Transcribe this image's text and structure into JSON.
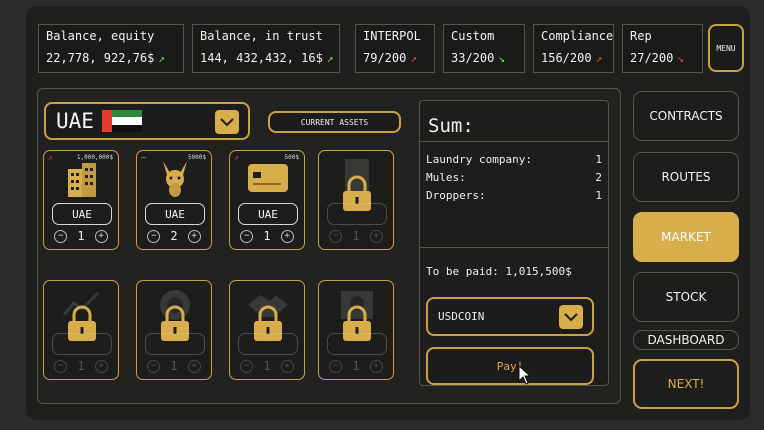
{
  "stats": [
    {
      "label": "Balance, equity",
      "value": "22,778, 922,76$",
      "trend": "up"
    },
    {
      "label": "Balance, in trust",
      "value": "144, 432,432, 16$",
      "trend": "up"
    },
    {
      "label": "INTERPOL",
      "value": "79/200",
      "trend": "down"
    },
    {
      "label": "Custom",
      "value": "33/200",
      "trend": "up"
    },
    {
      "label": "Compliance",
      "value": "156/200",
      "trend": "down"
    },
    {
      "label": "Rep",
      "value": "27/200",
      "trend": "down"
    }
  ],
  "menu_label": "MENU",
  "country": {
    "name": "UAE"
  },
  "current_assets_label": "CURRENT ASSETS",
  "cards": [
    {
      "icon": "building-icon",
      "amount": "1,000,000$",
      "label": "UAE",
      "qty": "1",
      "locked": false
    },
    {
      "icon": "donkey-icon",
      "amount": "5000$",
      "label": "UAE",
      "qty": "2",
      "locked": false
    },
    {
      "icon": "credit-card-icon",
      "amount": "500$",
      "label": "UAE",
      "qty": "1",
      "locked": false
    },
    {
      "icon": "document-icon",
      "amount": "",
      "label": "",
      "qty": "1",
      "locked": true
    },
    {
      "icon": "chart-icon",
      "amount": "",
      "label": "",
      "qty": "1",
      "locked": true
    },
    {
      "icon": "poker-chip-icon",
      "amount": "",
      "label": "",
      "qty": "1",
      "locked": true
    },
    {
      "icon": "handshake-icon",
      "amount": "",
      "label": "",
      "qty": "1",
      "locked": true
    },
    {
      "icon": "skull-icon",
      "amount": "",
      "label": "",
      "qty": "1",
      "locked": true
    }
  ],
  "sum": {
    "title": "Sum:",
    "rows": [
      {
        "label": "Laundry company:",
        "value": "1"
      },
      {
        "label": "Mules:",
        "value": "2"
      },
      {
        "label": "Droppers:",
        "value": "1"
      }
    ],
    "to_be_paid": "To be paid: 1,015,500$",
    "currency": "USDCOIN",
    "pay_label": "Pay!"
  },
  "nav": [
    "CONTRACTS",
    "ROUTES",
    "MARKET",
    "STOCK",
    "DASHBOARD",
    "NEXT!"
  ],
  "colors": {
    "gold": "#d8ad4c",
    "up": "#7ed957",
    "down": "#e84545"
  }
}
